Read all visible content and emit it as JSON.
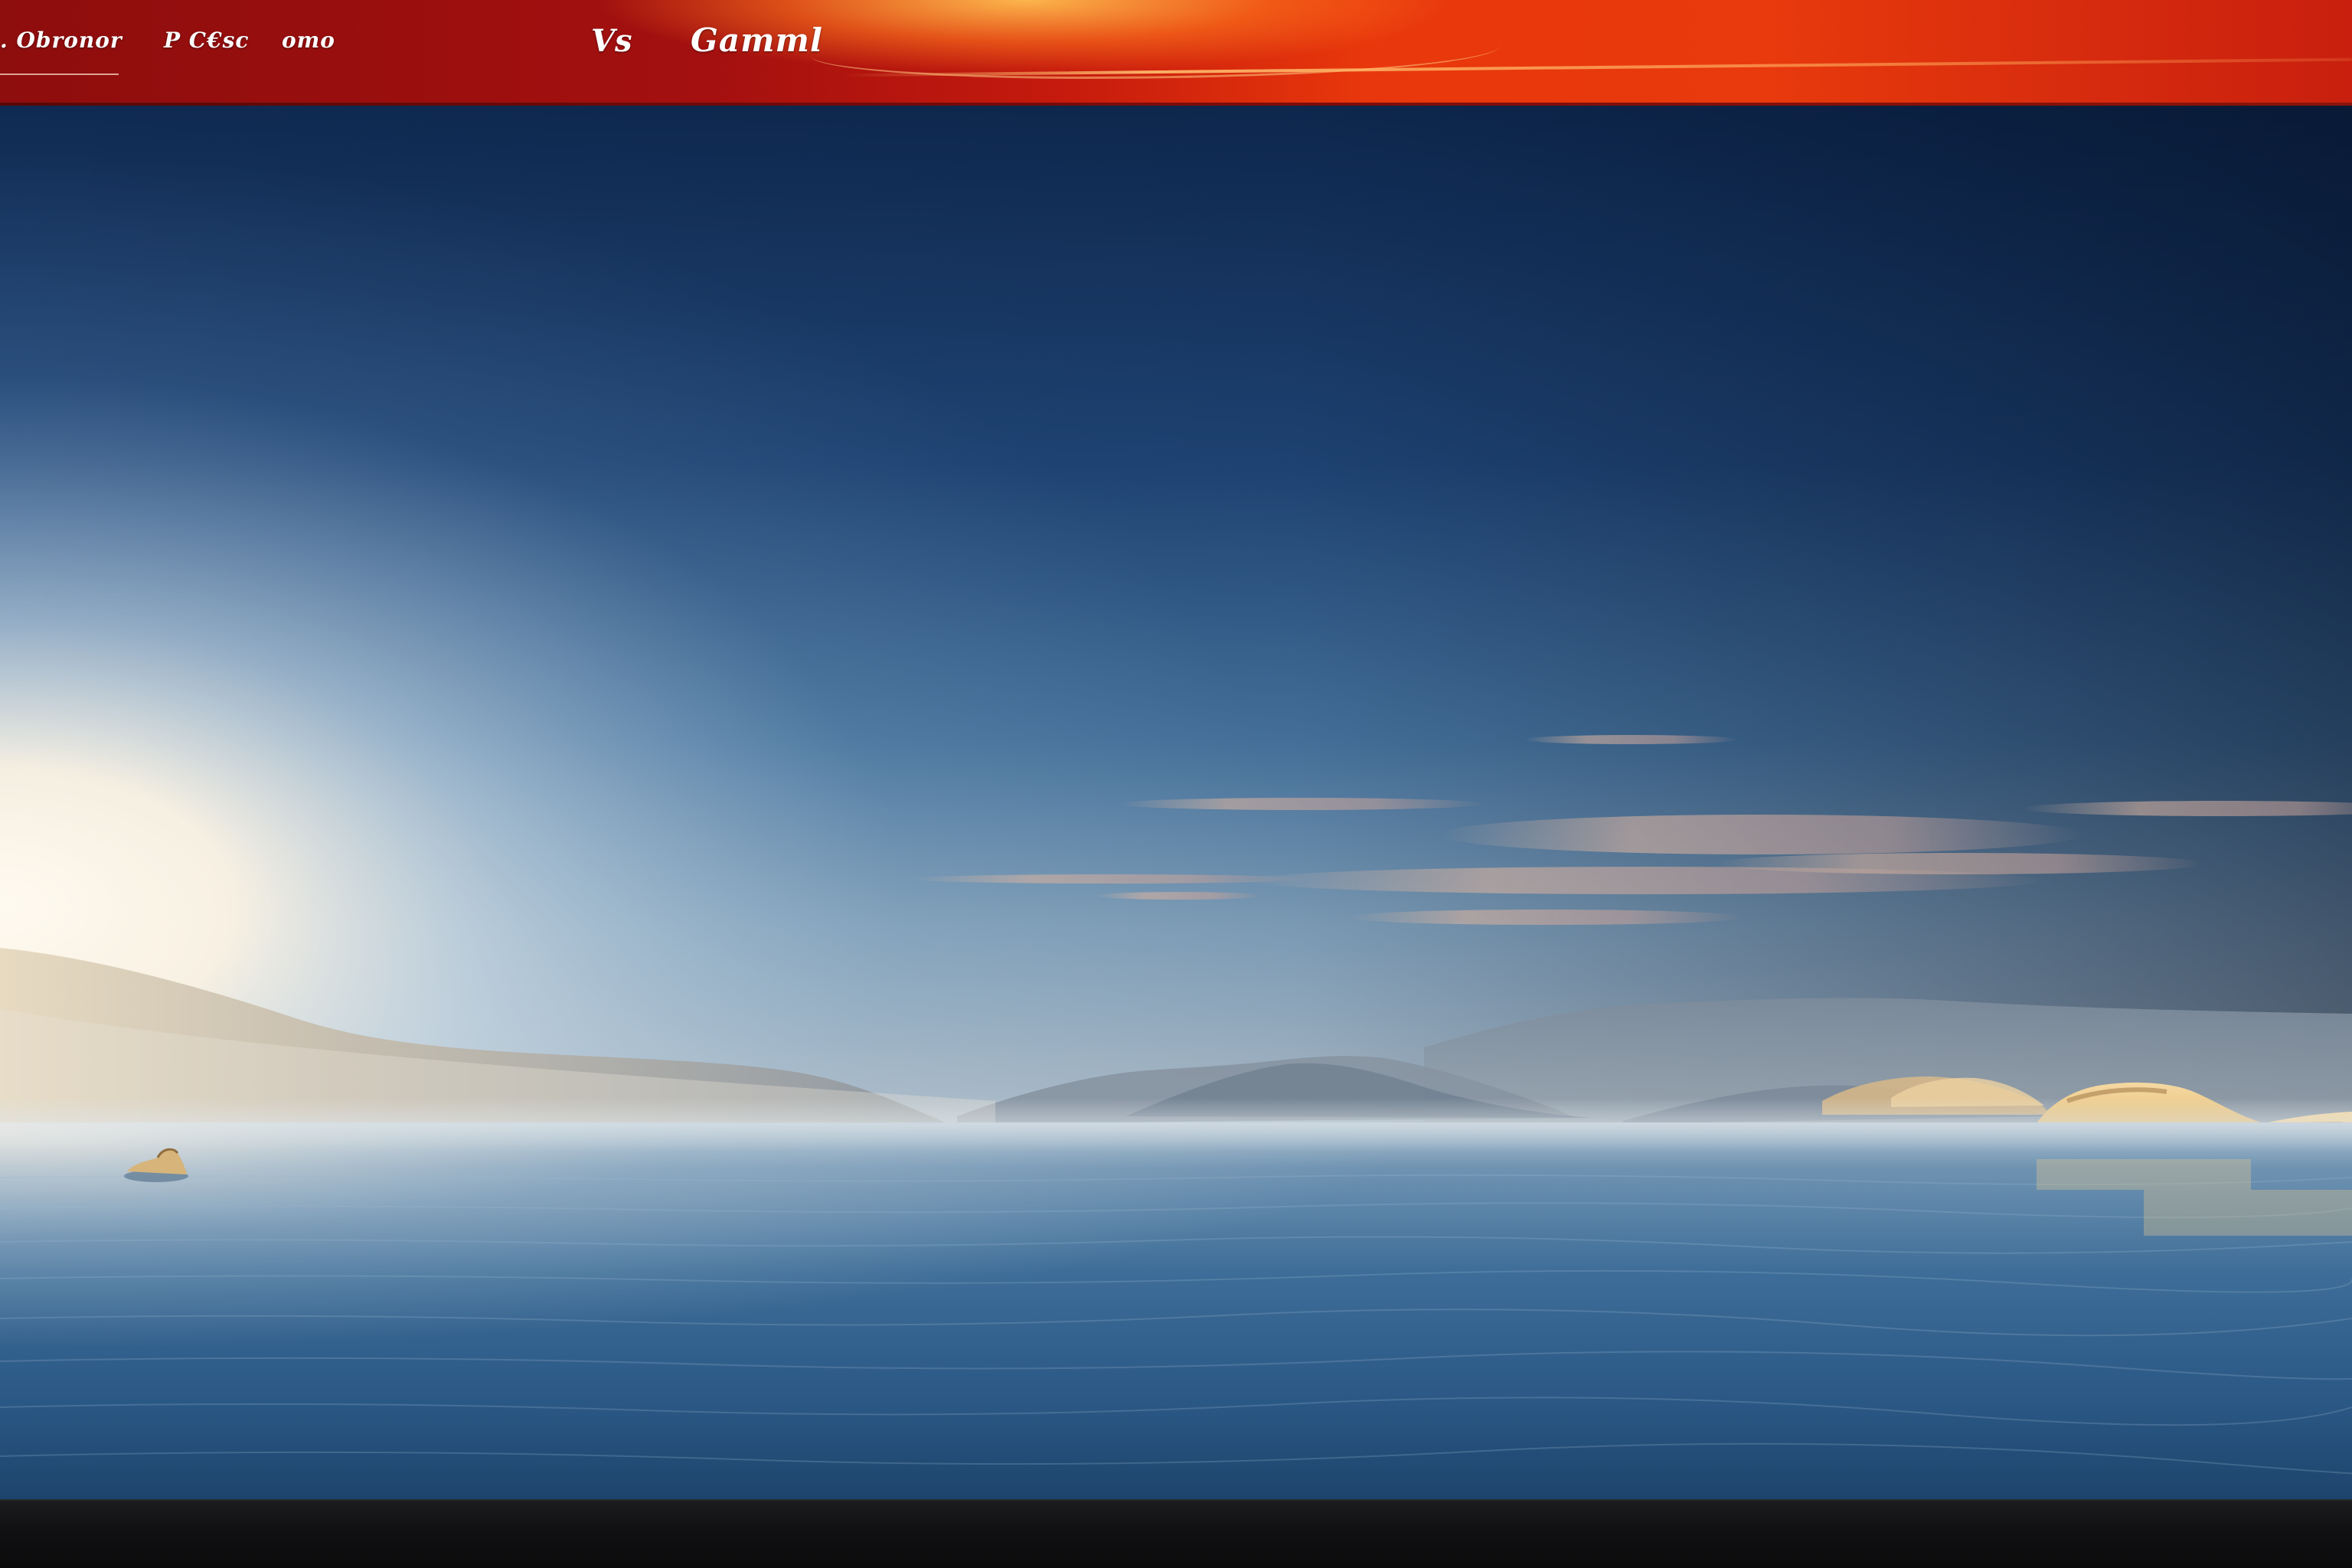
{
  "topbar": {
    "nav": [
      {
        "label": ". Obronor"
      },
      {
        "label": "P C€sc"
      },
      {
        "label": "omo"
      }
    ],
    "brand": {
      "mark": "Vs",
      "title": "Gamml"
    }
  },
  "colors": {
    "topbar_red": "#a3100f",
    "topbar_orange": "#e8370c",
    "sky_top": "#0c2348",
    "sky_horizon": "#f4eee2",
    "water": "#2d5f8f",
    "bottombar": "#111113"
  }
}
